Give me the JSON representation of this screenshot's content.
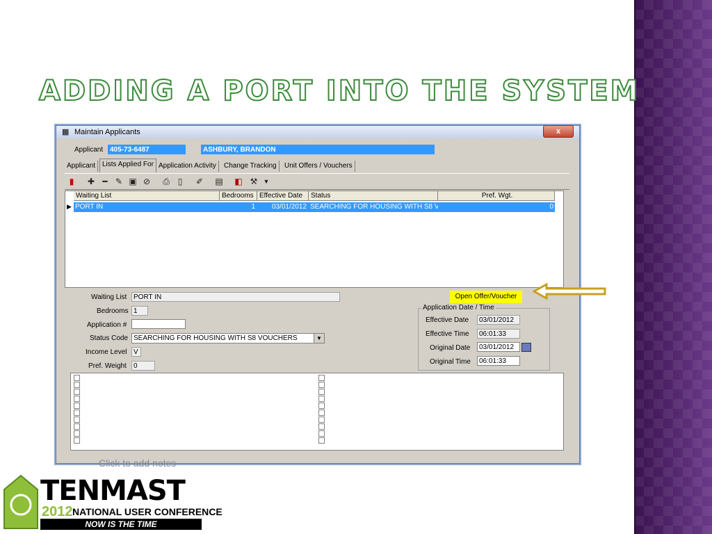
{
  "slide": {
    "title": "Adding a Port into the System",
    "notes_placeholder": "Click to add notes"
  },
  "window": {
    "title": "Maintain Applicants",
    "close_label": "x",
    "applicant_label": "Applicant",
    "applicant_id": "405-73-6487",
    "applicant_name": "ASHBURY, BRANDON"
  },
  "tabs": [
    "Applicant",
    "Lists Applied For",
    "Application Activity",
    "Change Tracking",
    "Unit Offers / Vouchers"
  ],
  "grid": {
    "headers": [
      "Waiting List",
      "Bedrooms",
      "Effective Date",
      "Status",
      "Pref. Wgt."
    ],
    "row": {
      "waiting_list": "PORT IN",
      "bedrooms": "1",
      "effective_date": "03/01/2012",
      "status": "SEARCHING FOR HOUSING WITH S8 V",
      "pref_wgt": "0"
    }
  },
  "form": {
    "waiting_list_label": "Waiting List",
    "waiting_list": "PORT IN",
    "bedrooms_label": "Bedrooms",
    "bedrooms": "1",
    "application_no_label": "Application #",
    "application_no": "",
    "status_code_label": "Status Code",
    "status_code": "SEARCHING FOR HOUSING WITH S8 VOUCHERS",
    "income_level_label": "Income Level",
    "income_level": "V",
    "pref_weight_label": "Pref. Weight",
    "pref_weight": "0"
  },
  "open_offer_label": "Open Offer/Voucher",
  "app_date_group": {
    "title": "Application Date / Time",
    "effective_date_label": "Effective Date",
    "effective_date": "03/01/2012",
    "effective_time_label": "Effective Time",
    "effective_time": "06:01:33",
    "original_date_label": "Original Date",
    "original_date": "03/01/2012",
    "original_time_label": "Original Time",
    "original_time": "06:01:33"
  },
  "logo": {
    "brand": "TENMAST",
    "year": "2012",
    "conference": "NATIONAL USER CONFERENCE",
    "tagline": "NOW IS THE TIME"
  },
  "colors": {
    "accent": "#3399ff",
    "title_outline": "#3b8a3b",
    "highlight": "#ffff00",
    "arrow": "#c8a020",
    "sidebar": "#4a2060"
  }
}
